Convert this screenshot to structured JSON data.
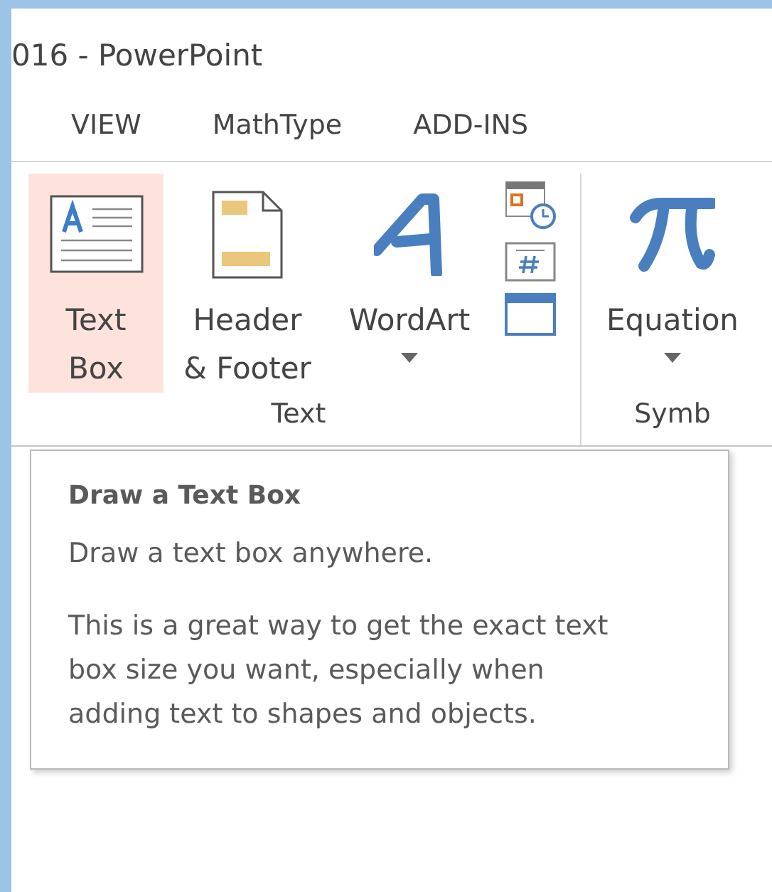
{
  "window": {
    "title": "016 - PowerPoint"
  },
  "tabs": [
    {
      "label": "VIEW"
    },
    {
      "label": "MathType"
    },
    {
      "label": "ADD-INS"
    }
  ],
  "ribbon_groups": [
    {
      "label": "Text",
      "buttons": [
        {
          "kind": "textbox",
          "label_lines": [
            "Text",
            "Box"
          ],
          "selected": true,
          "dropdown": false
        },
        {
          "kind": "header-footer",
          "label_lines": [
            "Header",
            "& Footer"
          ],
          "selected": false,
          "dropdown": false
        },
        {
          "kind": "wordart",
          "label_lines": [
            "WordArt"
          ],
          "selected": false,
          "dropdown": true
        },
        {
          "kind": "small-stack"
        }
      ]
    },
    {
      "label": "Symb",
      "buttons": [
        {
          "kind": "equation",
          "label_lines": [
            "Equation"
          ],
          "selected": false,
          "dropdown": true
        }
      ]
    }
  ],
  "tooltip": {
    "title": "Draw a Text Box",
    "paragraphs": [
      "Draw a text box anywhere.",
      "This is a great way to get the exact text box size you want, especially when adding text to shapes and objects."
    ]
  }
}
